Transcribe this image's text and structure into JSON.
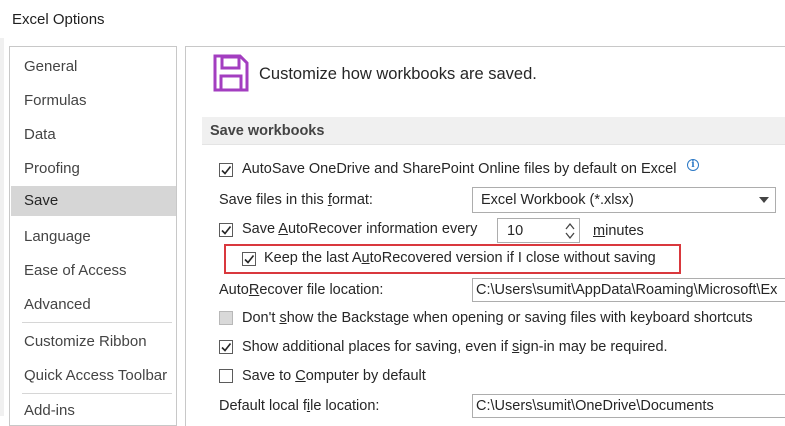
{
  "window": {
    "title": "Excel Options"
  },
  "sidebar": {
    "items": [
      {
        "label": "General",
        "selected": false
      },
      {
        "label": "Formulas",
        "selected": false
      },
      {
        "label": "Data",
        "selected": false
      },
      {
        "label": "Proofing",
        "selected": false
      },
      {
        "label": "Save",
        "selected": true
      },
      {
        "label": "Language",
        "selected": false
      },
      {
        "label": "Ease of Access",
        "selected": false
      },
      {
        "label": "Advanced",
        "selected": false
      },
      {
        "label": "Customize Ribbon",
        "selected": false
      },
      {
        "label": "Quick Access Toolbar",
        "selected": false
      },
      {
        "label": "Add-ins",
        "selected": false
      }
    ]
  },
  "main": {
    "header": {
      "icon": "save-icon",
      "text": "Customize how workbooks are saved."
    },
    "section_title": "Save workbooks",
    "autosave": {
      "label": "AutoSave OneDrive and SharePoint Online files by default on Excel",
      "checked": true,
      "info_icon": "info-icon",
      "info_glyph": "i"
    },
    "save_format": {
      "label_pre": "Save files in this ",
      "label_accel": "f",
      "label_post": "ormat:",
      "value": "Excel Workbook (*.xlsx)"
    },
    "autorecover_every": {
      "label_pre": "Save ",
      "label_accel": "A",
      "label_post": "utoRecover information every",
      "checked": true,
      "minutes_value": "10",
      "unit_accel": "m",
      "unit_post": "inutes"
    },
    "keep_last": {
      "label_pre": "Keep the last A",
      "label_accel": "u",
      "label_post": "toRecovered version if I close without saving",
      "checked": true
    },
    "autorecover_location": {
      "label_pre": "Auto",
      "label_accel": "R",
      "label_post": "ecover file location:",
      "value": "C:\\Users\\sumit\\AppData\\Roaming\\Microsoft\\Ex"
    },
    "dont_show_backstage": {
      "label_pre": "Don't ",
      "label_accel": "s",
      "label_post": "how the Backstage when opening or saving files with keyboard shortcuts",
      "checked": false,
      "disabled": true
    },
    "show_additional_places": {
      "label_pre": "Show additional places for saving, even if ",
      "label_accel": "s",
      "label_post": "ign-in may be required.",
      "checked": true
    },
    "save_to_computer": {
      "label_pre": "Save to ",
      "label_accel": "C",
      "label_post": "omputer by default",
      "checked": false
    },
    "default_local_location": {
      "label_pre": "Default local f",
      "label_accel": "i",
      "label_post": "le location:",
      "value": "C:\\Users\\sumit\\OneDrive\\Documents"
    }
  },
  "colors": {
    "highlight": "#d9383d",
    "selected_item": "#d6d6d6",
    "accent_icon": "#a33ec0"
  }
}
